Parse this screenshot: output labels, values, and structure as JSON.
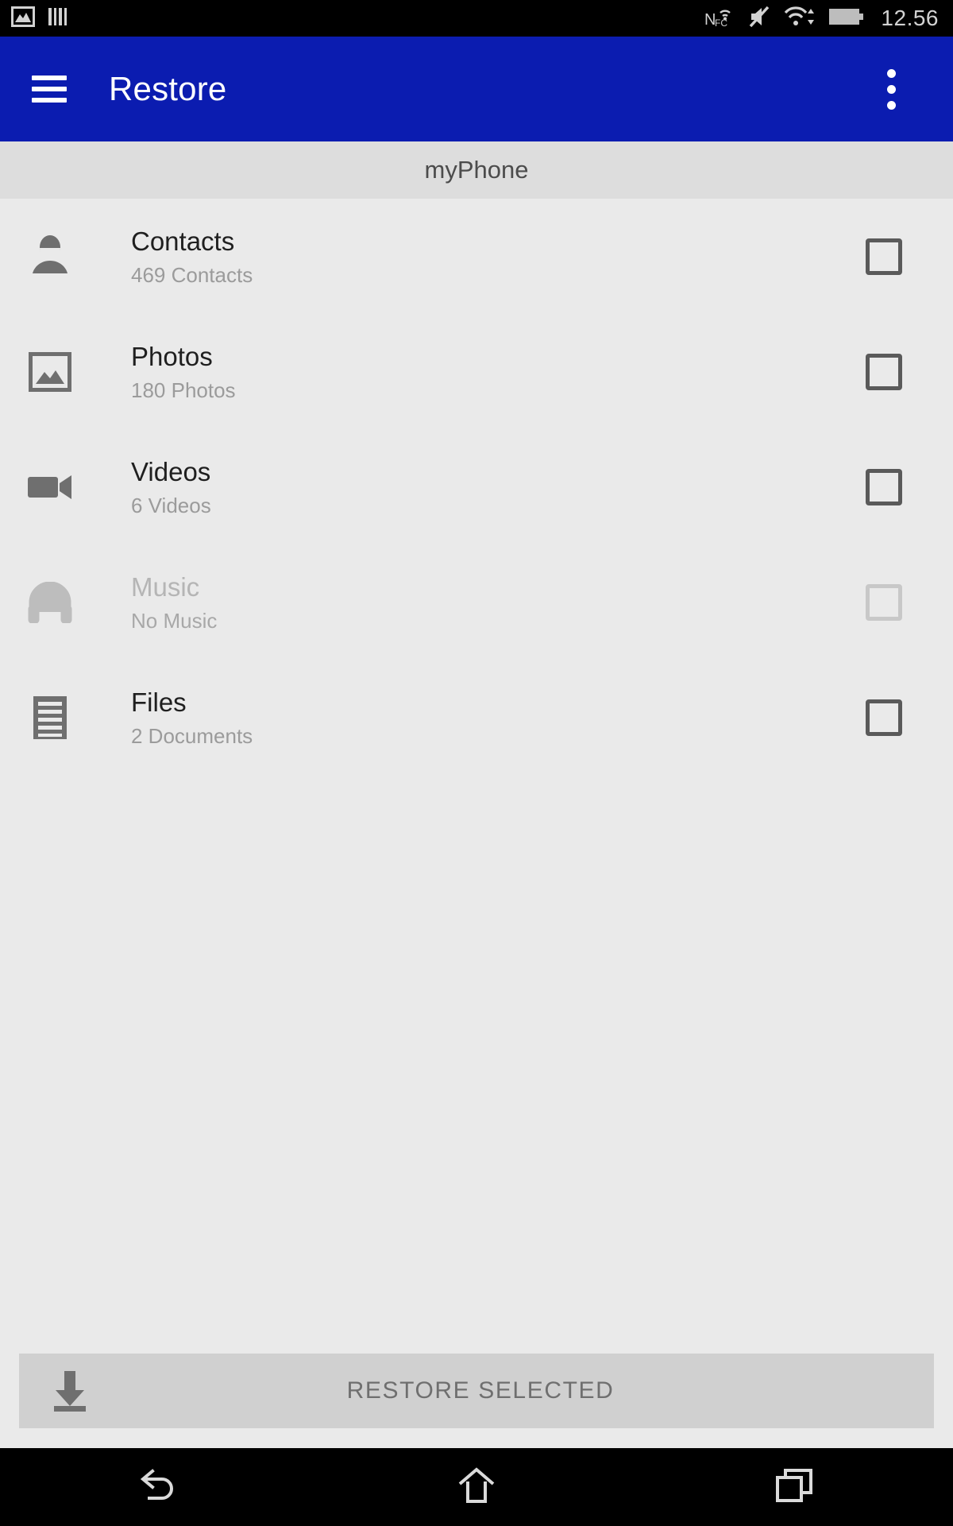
{
  "status_bar": {
    "left_icons": [
      {
        "name": "gallery-image-icon",
        "label": "Gallery"
      },
      {
        "name": "barcode-icon",
        "label": "Barcode"
      }
    ],
    "right_icons": [
      {
        "name": "nfc-icon",
        "label": "NFC"
      },
      {
        "name": "volume-mute-icon",
        "label": "Silent"
      },
      {
        "name": "wifi-transfer-icon",
        "label": "Wi-Fi"
      },
      {
        "name": "battery-icon",
        "label": "Battery"
      }
    ],
    "time": "12.56",
    "background": "#000000",
    "icon_color": "#d2d2d2"
  },
  "app_bar": {
    "title": "Restore",
    "menu_icon": "hamburger-menu-icon",
    "overflow_icon": "overflow-menu-icon",
    "background": "#0b1cb0",
    "text_color": "#ffffff"
  },
  "subheader": {
    "label": "myPhone",
    "background": "#dddddd",
    "text_color": "#4c4c4c"
  },
  "list": {
    "items": [
      {
        "id": "contacts",
        "icon": "person-icon",
        "title": "Contacts",
        "subtitle": "469 Contacts",
        "checked": false,
        "enabled": true
      },
      {
        "id": "photos",
        "icon": "photo-icon",
        "title": "Photos",
        "subtitle": "180 Photos",
        "checked": false,
        "enabled": true
      },
      {
        "id": "videos",
        "icon": "video-camera-icon",
        "title": "Videos",
        "subtitle": "6 Videos",
        "checked": false,
        "enabled": true
      },
      {
        "id": "music",
        "icon": "headphones-icon",
        "title": "Music",
        "subtitle": "No Music",
        "checked": false,
        "enabled": false
      },
      {
        "id": "files",
        "icon": "document-icon",
        "title": "Files",
        "subtitle": "2 Documents",
        "checked": false,
        "enabled": true
      }
    ]
  },
  "restore_button": {
    "label": "RESTORE SELECTED",
    "icon": "download-icon",
    "background": "#d0d0d0",
    "text_color": "#6f6f6f"
  },
  "nav_bar": {
    "buttons": [
      {
        "name": "back-button",
        "icon": "back-arrow-icon"
      },
      {
        "name": "home-button",
        "icon": "home-icon"
      },
      {
        "name": "recents-button",
        "icon": "recents-icon"
      }
    ],
    "background": "#000000"
  },
  "colors": {
    "content_background": "#eaeaea",
    "accent_blue": "#0b1cb0",
    "icon_gray": "#6f6f6f",
    "disabled_gray": "#bdbdbd"
  }
}
